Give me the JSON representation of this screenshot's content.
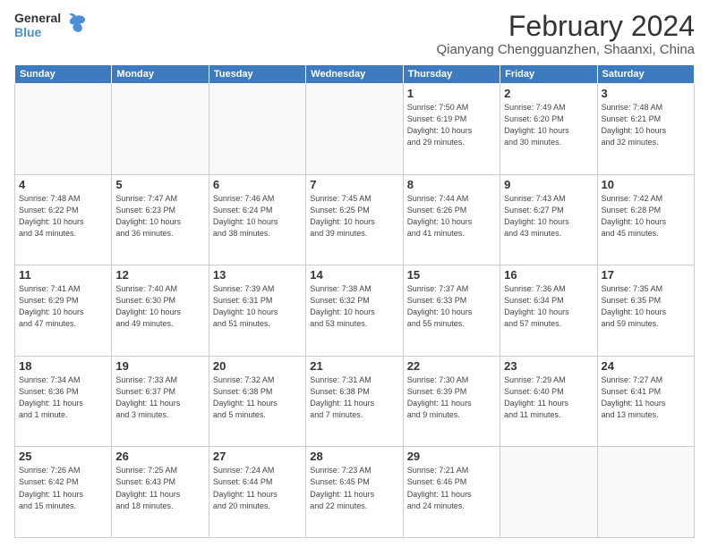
{
  "logo": {
    "general": "General",
    "blue": "Blue"
  },
  "title": {
    "month": "February 2024",
    "location": "Qianyang Chengguanzhen, Shaanxi, China"
  },
  "weekdays": [
    "Sunday",
    "Monday",
    "Tuesday",
    "Wednesday",
    "Thursday",
    "Friday",
    "Saturday"
  ],
  "weeks": [
    [
      {
        "day": "",
        "info": ""
      },
      {
        "day": "",
        "info": ""
      },
      {
        "day": "",
        "info": ""
      },
      {
        "day": "",
        "info": ""
      },
      {
        "day": "1",
        "info": "Sunrise: 7:50 AM\nSunset: 6:19 PM\nDaylight: 10 hours\nand 29 minutes."
      },
      {
        "day": "2",
        "info": "Sunrise: 7:49 AM\nSunset: 6:20 PM\nDaylight: 10 hours\nand 30 minutes."
      },
      {
        "day": "3",
        "info": "Sunrise: 7:48 AM\nSunset: 6:21 PM\nDaylight: 10 hours\nand 32 minutes."
      }
    ],
    [
      {
        "day": "4",
        "info": "Sunrise: 7:48 AM\nSunset: 6:22 PM\nDaylight: 10 hours\nand 34 minutes."
      },
      {
        "day": "5",
        "info": "Sunrise: 7:47 AM\nSunset: 6:23 PM\nDaylight: 10 hours\nand 36 minutes."
      },
      {
        "day": "6",
        "info": "Sunrise: 7:46 AM\nSunset: 6:24 PM\nDaylight: 10 hours\nand 38 minutes."
      },
      {
        "day": "7",
        "info": "Sunrise: 7:45 AM\nSunset: 6:25 PM\nDaylight: 10 hours\nand 39 minutes."
      },
      {
        "day": "8",
        "info": "Sunrise: 7:44 AM\nSunset: 6:26 PM\nDaylight: 10 hours\nand 41 minutes."
      },
      {
        "day": "9",
        "info": "Sunrise: 7:43 AM\nSunset: 6:27 PM\nDaylight: 10 hours\nand 43 minutes."
      },
      {
        "day": "10",
        "info": "Sunrise: 7:42 AM\nSunset: 6:28 PM\nDaylight: 10 hours\nand 45 minutes."
      }
    ],
    [
      {
        "day": "11",
        "info": "Sunrise: 7:41 AM\nSunset: 6:29 PM\nDaylight: 10 hours\nand 47 minutes."
      },
      {
        "day": "12",
        "info": "Sunrise: 7:40 AM\nSunset: 6:30 PM\nDaylight: 10 hours\nand 49 minutes."
      },
      {
        "day": "13",
        "info": "Sunrise: 7:39 AM\nSunset: 6:31 PM\nDaylight: 10 hours\nand 51 minutes."
      },
      {
        "day": "14",
        "info": "Sunrise: 7:38 AM\nSunset: 6:32 PM\nDaylight: 10 hours\nand 53 minutes."
      },
      {
        "day": "15",
        "info": "Sunrise: 7:37 AM\nSunset: 6:33 PM\nDaylight: 10 hours\nand 55 minutes."
      },
      {
        "day": "16",
        "info": "Sunrise: 7:36 AM\nSunset: 6:34 PM\nDaylight: 10 hours\nand 57 minutes."
      },
      {
        "day": "17",
        "info": "Sunrise: 7:35 AM\nSunset: 6:35 PM\nDaylight: 10 hours\nand 59 minutes."
      }
    ],
    [
      {
        "day": "18",
        "info": "Sunrise: 7:34 AM\nSunset: 6:36 PM\nDaylight: 11 hours\nand 1 minute."
      },
      {
        "day": "19",
        "info": "Sunrise: 7:33 AM\nSunset: 6:37 PM\nDaylight: 11 hours\nand 3 minutes."
      },
      {
        "day": "20",
        "info": "Sunrise: 7:32 AM\nSunset: 6:38 PM\nDaylight: 11 hours\nand 5 minutes."
      },
      {
        "day": "21",
        "info": "Sunrise: 7:31 AM\nSunset: 6:38 PM\nDaylight: 11 hours\nand 7 minutes."
      },
      {
        "day": "22",
        "info": "Sunrise: 7:30 AM\nSunset: 6:39 PM\nDaylight: 11 hours\nand 9 minutes."
      },
      {
        "day": "23",
        "info": "Sunrise: 7:29 AM\nSunset: 6:40 PM\nDaylight: 11 hours\nand 11 minutes."
      },
      {
        "day": "24",
        "info": "Sunrise: 7:27 AM\nSunset: 6:41 PM\nDaylight: 11 hours\nand 13 minutes."
      }
    ],
    [
      {
        "day": "25",
        "info": "Sunrise: 7:26 AM\nSunset: 6:42 PM\nDaylight: 11 hours\nand 15 minutes."
      },
      {
        "day": "26",
        "info": "Sunrise: 7:25 AM\nSunset: 6:43 PM\nDaylight: 11 hours\nand 18 minutes."
      },
      {
        "day": "27",
        "info": "Sunrise: 7:24 AM\nSunset: 6:44 PM\nDaylight: 11 hours\nand 20 minutes."
      },
      {
        "day": "28",
        "info": "Sunrise: 7:23 AM\nSunset: 6:45 PM\nDaylight: 11 hours\nand 22 minutes."
      },
      {
        "day": "29",
        "info": "Sunrise: 7:21 AM\nSunset: 6:46 PM\nDaylight: 11 hours\nand 24 minutes."
      },
      {
        "day": "",
        "info": ""
      },
      {
        "day": "",
        "info": ""
      }
    ]
  ]
}
